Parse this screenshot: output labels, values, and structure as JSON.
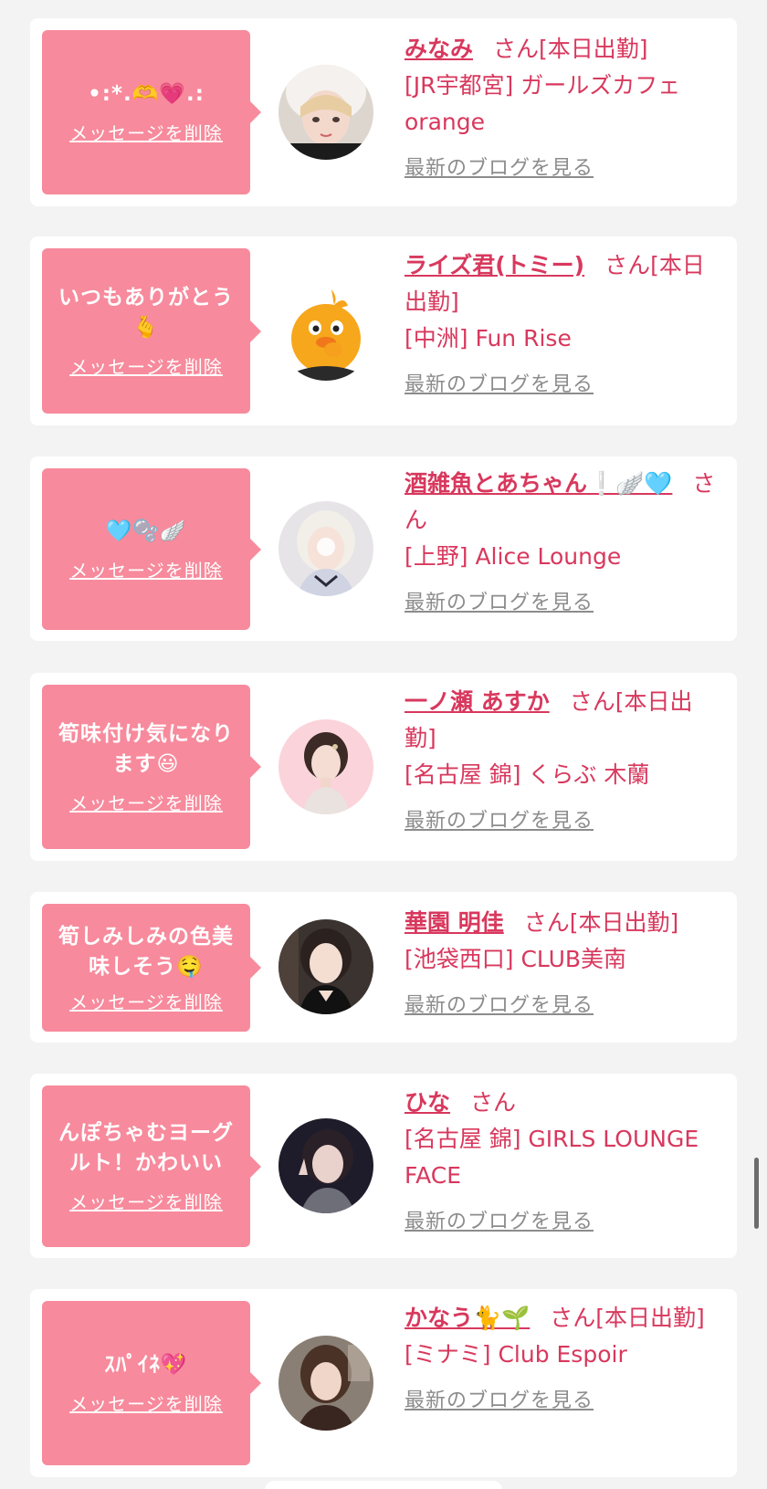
{
  "common": {
    "delete_label": "メッセージを削除",
    "san": "さん",
    "blog_label": "最新のブログを見る"
  },
  "colors": {
    "bubble": "#f78a9c",
    "accent": "#d8385d",
    "link_gray": "#8c8c8c",
    "background": "#f3f3f3"
  },
  "cards": [
    {
      "message": "•:*.🫶💗.:",
      "name": "みなみ",
      "status": "[本日出勤]",
      "shop": "[JR宇都宮] ガールズカフェ orange",
      "avatar": "avatar-photo-1"
    },
    {
      "message": "いつもありがとう🫰",
      "name": "ライズ君(トミー)",
      "status": "[本日出勤]",
      "shop": "[中洲] Fun Rise",
      "avatar": "avatar-mascot-yellow-chick"
    },
    {
      "message": "🩵🫧🪽",
      "name": "酒雑魚とあちゃん❕🪽🩵",
      "status": "",
      "shop": "[上野] Alice Lounge",
      "avatar": "avatar-photo-3"
    },
    {
      "message": "筍味付け気になります😃",
      "name": "一ノ瀬 あすか",
      "status": "[本日出勤]",
      "shop": "[名古屋 錦] くらぶ 木蘭",
      "avatar": "avatar-photo-4"
    },
    {
      "message": "筍しみしみの色美味しそう🤤",
      "name": "華園 明佳",
      "status": "[本日出勤]",
      "shop": "[池袋西口] CLUB美南",
      "avatar": "avatar-photo-5"
    },
    {
      "message": "んぽちゃむヨーグルト！かわいい",
      "name": "ひな",
      "status": "",
      "shop": "[名古屋 錦] GIRLS LOUNGE FACE",
      "avatar": "avatar-photo-6"
    },
    {
      "message": "ｽﾊﾟｲﾈ💖",
      "name": "かなう🐈🌱",
      "status": "[本日出勤]",
      "shop": "[ミナミ] Club Espoir",
      "avatar": "avatar-photo-7"
    }
  ]
}
